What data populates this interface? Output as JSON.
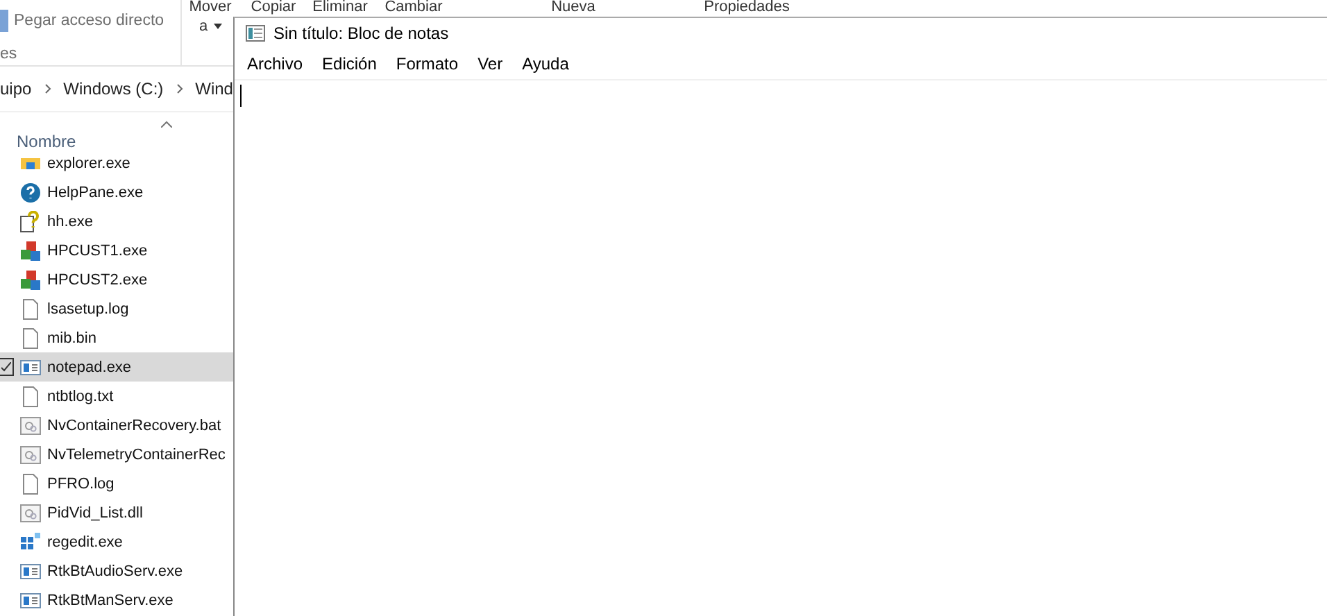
{
  "explorer": {
    "ribbon": {
      "paste_shortcut": "Pegar acceso directo",
      "group_label": "es",
      "commands": [
        {
          "label": "Mover",
          "sub": "a",
          "dropdown": true
        },
        {
          "label": "Copiar"
        },
        {
          "label": "Eliminar"
        },
        {
          "label": "Cambiar"
        },
        {
          "label": "Nueva"
        },
        {
          "label": "Propiedades"
        }
      ]
    },
    "breadcrumb": [
      "uipo",
      "Windows (C:)",
      "Wind"
    ],
    "column_header": "Nombre",
    "files": [
      {
        "name": "explorer.exe",
        "kind": "explorer",
        "selected": false
      },
      {
        "name": "HelpPane.exe",
        "kind": "help",
        "selected": false
      },
      {
        "name": "hh.exe",
        "kind": "hh",
        "selected": false
      },
      {
        "name": "HPCUST1.exe",
        "kind": "hp",
        "selected": false
      },
      {
        "name": "HPCUST2.exe",
        "kind": "hp",
        "selected": false
      },
      {
        "name": "lsasetup.log",
        "kind": "file",
        "selected": false
      },
      {
        "name": "mib.bin",
        "kind": "file",
        "selected": false
      },
      {
        "name": "notepad.exe",
        "kind": "app",
        "selected": true
      },
      {
        "name": "ntbtlog.txt",
        "kind": "file",
        "selected": false
      },
      {
        "name": "NvContainerRecovery.bat",
        "kind": "gear",
        "selected": false
      },
      {
        "name": "NvTelemetryContainerRec",
        "kind": "gear",
        "selected": false
      },
      {
        "name": "PFRO.log",
        "kind": "file",
        "selected": false
      },
      {
        "name": "PidVid_List.dll",
        "kind": "gear",
        "selected": false
      },
      {
        "name": "regedit.exe",
        "kind": "regedit",
        "selected": false
      },
      {
        "name": "RtkBtAudioServ.exe",
        "kind": "app",
        "selected": false
      },
      {
        "name": "RtkBtManServ.exe",
        "kind": "app",
        "selected": false
      }
    ]
  },
  "notepad": {
    "title": "Sin título: Bloc de notas",
    "menu": [
      "Archivo",
      "Edición",
      "Formato",
      "Ver",
      "Ayuda"
    ]
  }
}
